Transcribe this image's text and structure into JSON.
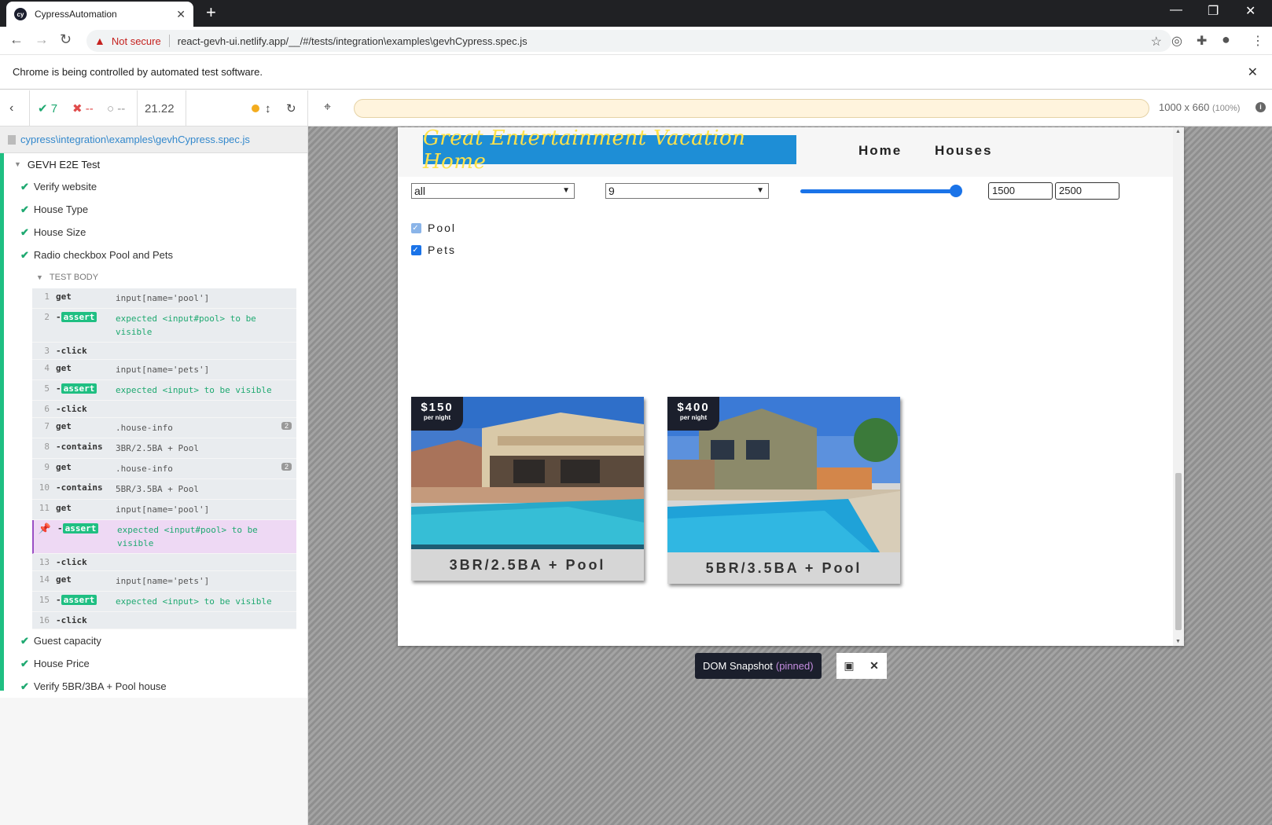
{
  "browser": {
    "tab_title": "CypressAutomation",
    "not_secure": "Not secure",
    "url": "react-gevh-ui.netlify.app/__/#/tests/integration\\examples\\gevhCypress.spec.js",
    "infobar_text": "Chrome is being controlled by automated test software."
  },
  "reporter": {
    "passed": "7",
    "failed": "--",
    "pending": "--",
    "duration": "21.22",
    "spec_path": "cypress\\integration\\examples\\gevhCypress.spec.js",
    "suite_title": "GEVH E2E Test",
    "tests_before": [
      "Verify website",
      "House Type",
      "House Size",
      "Radio checkbox Pool and Pets"
    ],
    "body_label": "TEST BODY",
    "commands": [
      {
        "num": "1",
        "name": "get",
        "msg": "input[name='pool']"
      },
      {
        "num": "2",
        "name": "assert",
        "msg": "expected <input#pool> to be visible"
      },
      {
        "num": "3",
        "name": "-click",
        "msg": ""
      },
      {
        "num": "4",
        "name": "get",
        "msg": "input[name='pets']"
      },
      {
        "num": "5",
        "name": "assert",
        "msg": "expected <input> to be visible"
      },
      {
        "num": "6",
        "name": "-click",
        "msg": ""
      },
      {
        "num": "7",
        "name": "get",
        "msg": ".house-info",
        "count": "2"
      },
      {
        "num": "8",
        "name": "-contains",
        "msg": "3BR/2.5BA + Pool"
      },
      {
        "num": "9",
        "name": "get",
        "msg": ".house-info",
        "count": "2"
      },
      {
        "num": "10",
        "name": "-contains",
        "msg": "5BR/3.5BA + Pool"
      },
      {
        "num": "11",
        "name": "get",
        "msg": "input[name='pool']"
      },
      {
        "num": "12",
        "name": "assert",
        "msg": "expected <input#pool> to be visible",
        "pinned": true
      },
      {
        "num": "13",
        "name": "-click",
        "msg": ""
      },
      {
        "num": "14",
        "name": "get",
        "msg": "input[name='pets']"
      },
      {
        "num": "15",
        "name": "assert",
        "msg": "expected <input> to be visible"
      },
      {
        "num": "16",
        "name": "-click",
        "msg": ""
      }
    ],
    "tests_after": [
      "Guest capacity",
      "House Price",
      "Verify 5BR/3BA + Pool house"
    ]
  },
  "aut": {
    "viewport": "1000 x 660",
    "viewport_pct": "(100%)",
    "snapshot_label": "DOM Snapshot",
    "snapshot_pinned": "(pinned)"
  },
  "app": {
    "logo_text": "Great Entertainment Vacation Home",
    "nav": [
      "Home",
      "Houses"
    ],
    "type_select": "all",
    "size_select": "9",
    "price_slider_fraction": 1.0,
    "min_price": "1500",
    "max_price": "2500",
    "checkbox_pool": "Pool",
    "checkbox_pets": "Pets",
    "houses": [
      {
        "price": "$150",
        "per": "per night",
        "info": "3BR/2.5BA + Pool"
      },
      {
        "price": "$400",
        "per": "per night",
        "info": "5BR/3.5BA + Pool"
      }
    ]
  },
  "colors": {
    "pass": "#1fa971",
    "fail": "#e04b4b",
    "accent": "#1fbf82",
    "pinned": "#9a4fc4",
    "logo_bg": "#1e8ed6",
    "logo_text": "#ffe24a"
  }
}
